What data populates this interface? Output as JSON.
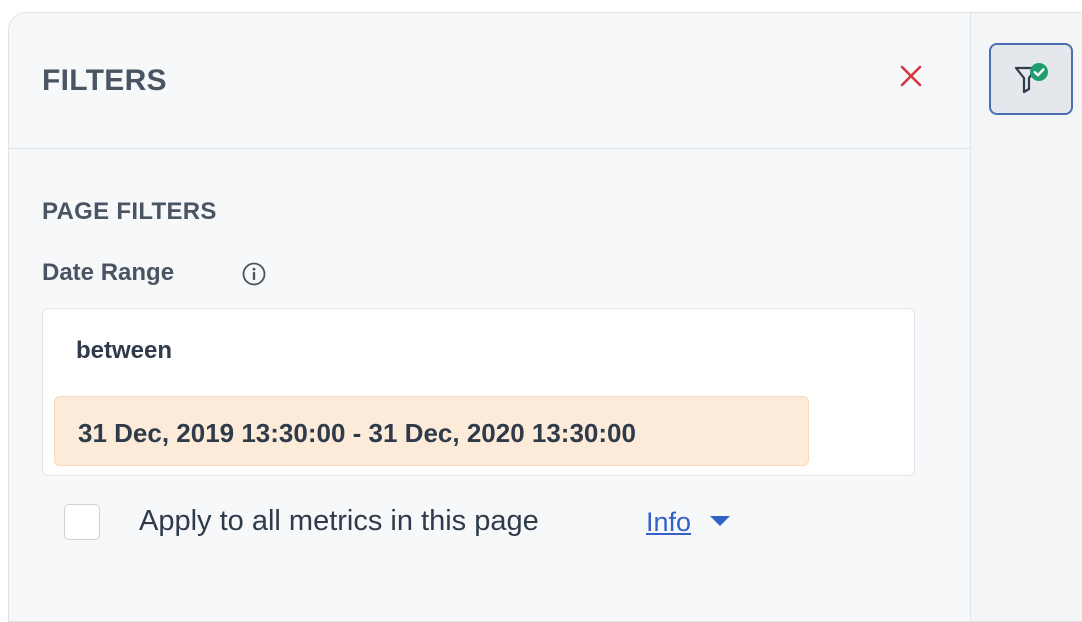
{
  "panel": {
    "title": "FILTERS",
    "close_icon": "close-icon"
  },
  "page_filters": {
    "section_title": "PAGE FILTERS",
    "date_range": {
      "label": "Date Range",
      "info_icon": "info-circle-icon",
      "operator": "between",
      "value": "31 Dec, 2019 13:30:00 - 31 Dec, 2020 13:30:00"
    },
    "apply_all": {
      "checked": false,
      "label": "Apply to all metrics in this page",
      "info_link": "Info",
      "info_caret_icon": "caret-down-icon"
    }
  },
  "side_rail": {
    "filter_toggle_icon": "filter-check-icon",
    "active": true
  },
  "colors": {
    "accent": "#3461c8",
    "close": "#d9363e",
    "chip_bg": "#fdebd9",
    "check_badge": "#1f9d6e",
    "text": "#2f3b4a",
    "muted_text": "#4a5563"
  }
}
